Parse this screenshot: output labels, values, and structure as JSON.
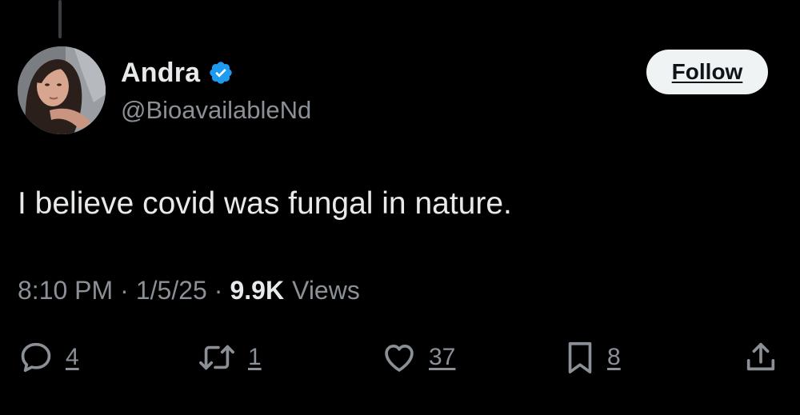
{
  "author": {
    "display_name": "Andra",
    "handle": "@BioavailableNd",
    "verified": true
  },
  "follow_button": {
    "label": "Follow"
  },
  "tweet": {
    "text": "I believe covid was fungal in nature.",
    "time": "8:10 PM",
    "date": "1/5/25",
    "separator": "·",
    "views_count": "9.9K",
    "views_label": "Views"
  },
  "actions": {
    "reply_count": "4",
    "retweet_count": "1",
    "like_count": "37",
    "bookmark_count": "8"
  },
  "colors": {
    "background": "#000000",
    "primary_text": "#e7e9ea",
    "secondary_text": "#8b9096",
    "verified_blue": "#1d9bf0",
    "follow_button_bg": "#eff3f4"
  },
  "icons": {
    "verified": "verified-badge-icon",
    "reply": "speech-bubble-icon",
    "retweet": "retweet-arrows-icon",
    "like": "heart-icon",
    "bookmark": "bookmark-icon",
    "share": "share-upload-icon"
  }
}
